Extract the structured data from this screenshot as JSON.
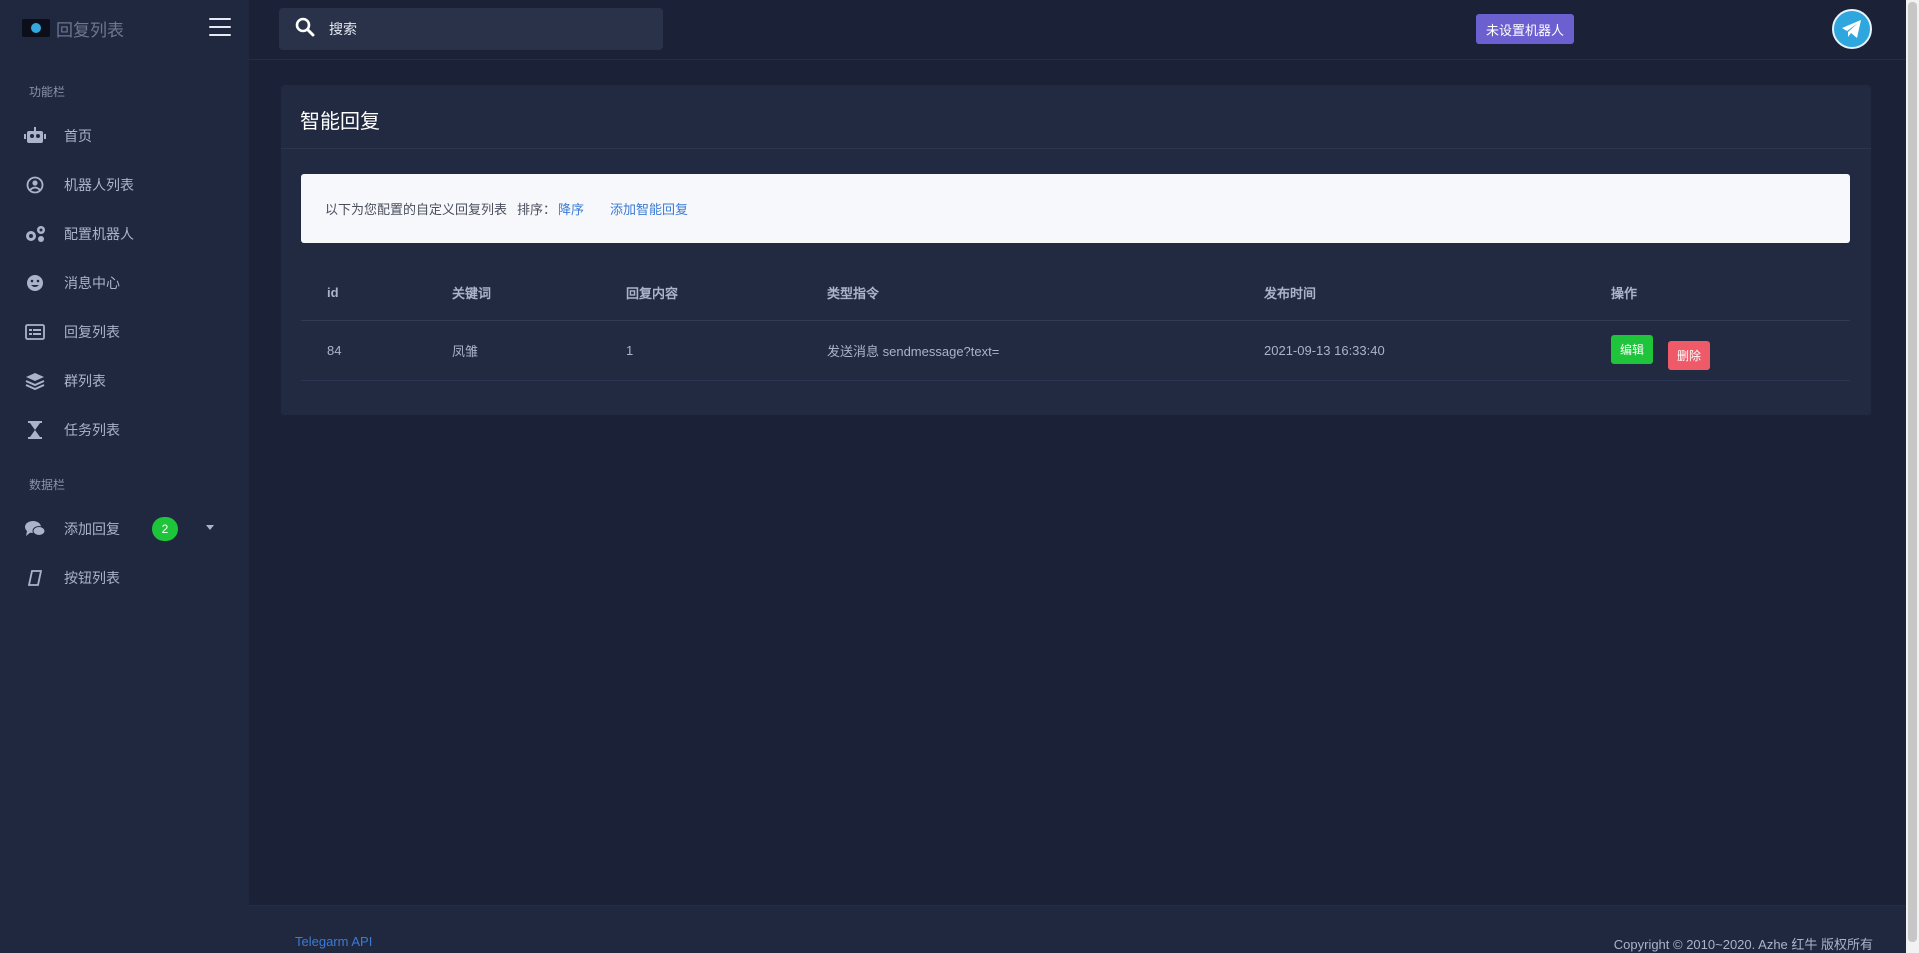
{
  "sidebar": {
    "brand_title": "回复列表",
    "section_functions": "功能栏",
    "section_data": "数据栏",
    "items": [
      {
        "label": "首页",
        "icon": "robot-icon"
      },
      {
        "label": "机器人列表",
        "icon": "user-circle-icon"
      },
      {
        "label": "配置机器人",
        "icon": "cogs-icon"
      },
      {
        "label": "消息中心",
        "icon": "smile-icon"
      },
      {
        "label": "回复列表",
        "icon": "list-alt-icon"
      },
      {
        "label": "群列表",
        "icon": "layers-icon"
      },
      {
        "label": "任务列表",
        "icon": "hourglass-icon"
      }
    ],
    "data_items": [
      {
        "label": "添加回复",
        "icon": "comments-icon",
        "badge": "2"
      },
      {
        "label": "按钮列表",
        "icon": "sticky-note-icon"
      }
    ]
  },
  "header": {
    "search_placeholder": "搜索",
    "robot_button": "未设置机器人"
  },
  "card": {
    "title": "智能回复",
    "info_text": "以下为您配置的自定义回复列表",
    "sort_label": "排序：",
    "sort_value": "降序",
    "add_link": "添加智能回复"
  },
  "table": {
    "headers": [
      "id",
      "关键词",
      "回复内容",
      "类型指令",
      "发布时间",
      "操作"
    ],
    "rows": [
      {
        "id": "84",
        "keyword": "凤雏",
        "content": "1",
        "type": "发送消息 sendmessage?text=",
        "time": "2021-09-13 16:33:40",
        "edit": "编辑",
        "delete": "删除"
      }
    ]
  },
  "footer": {
    "api_link": "Telegarm API",
    "copyright": "Copyright © 2010~2020. Azhe 红牛 版权所有"
  },
  "colors": {
    "background": "#1b2238",
    "sidebar": "#20283f",
    "accent_purple": "#6c5fd0",
    "success": "#1ec43a",
    "danger": "#ee5a68",
    "link": "#3a7bd5"
  }
}
